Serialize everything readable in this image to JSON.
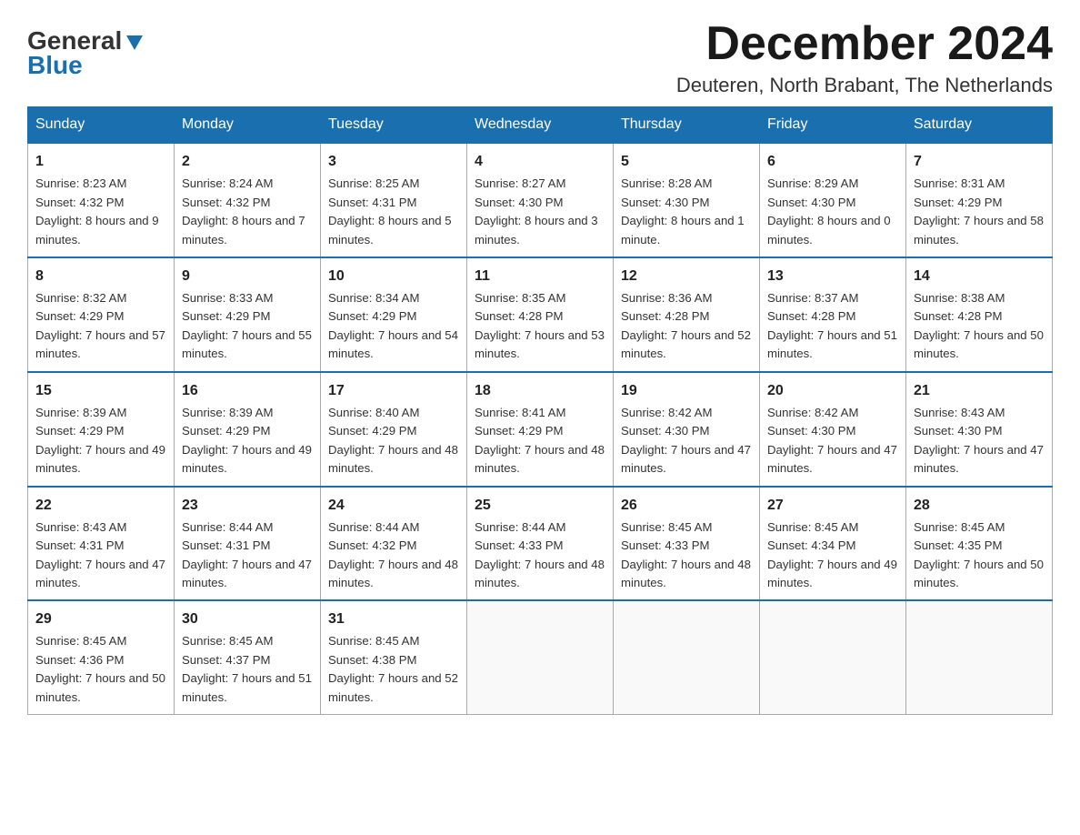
{
  "logo": {
    "text_general": "General",
    "text_blue": "Blue"
  },
  "header": {
    "month_title": "December 2024",
    "location": "Deuteren, North Brabant, The Netherlands"
  },
  "weekdays": [
    "Sunday",
    "Monday",
    "Tuesday",
    "Wednesday",
    "Thursday",
    "Friday",
    "Saturday"
  ],
  "weeks": [
    [
      {
        "day": "1",
        "sunrise": "8:23 AM",
        "sunset": "4:32 PM",
        "daylight": "8 hours and 9 minutes."
      },
      {
        "day": "2",
        "sunrise": "8:24 AM",
        "sunset": "4:32 PM",
        "daylight": "8 hours and 7 minutes."
      },
      {
        "day": "3",
        "sunrise": "8:25 AM",
        "sunset": "4:31 PM",
        "daylight": "8 hours and 5 minutes."
      },
      {
        "day": "4",
        "sunrise": "8:27 AM",
        "sunset": "4:30 PM",
        "daylight": "8 hours and 3 minutes."
      },
      {
        "day": "5",
        "sunrise": "8:28 AM",
        "sunset": "4:30 PM",
        "daylight": "8 hours and 1 minute."
      },
      {
        "day": "6",
        "sunrise": "8:29 AM",
        "sunset": "4:30 PM",
        "daylight": "8 hours and 0 minutes."
      },
      {
        "day": "7",
        "sunrise": "8:31 AM",
        "sunset": "4:29 PM",
        "daylight": "7 hours and 58 minutes."
      }
    ],
    [
      {
        "day": "8",
        "sunrise": "8:32 AM",
        "sunset": "4:29 PM",
        "daylight": "7 hours and 57 minutes."
      },
      {
        "day": "9",
        "sunrise": "8:33 AM",
        "sunset": "4:29 PM",
        "daylight": "7 hours and 55 minutes."
      },
      {
        "day": "10",
        "sunrise": "8:34 AM",
        "sunset": "4:29 PM",
        "daylight": "7 hours and 54 minutes."
      },
      {
        "day": "11",
        "sunrise": "8:35 AM",
        "sunset": "4:28 PM",
        "daylight": "7 hours and 53 minutes."
      },
      {
        "day": "12",
        "sunrise": "8:36 AM",
        "sunset": "4:28 PM",
        "daylight": "7 hours and 52 minutes."
      },
      {
        "day": "13",
        "sunrise": "8:37 AM",
        "sunset": "4:28 PM",
        "daylight": "7 hours and 51 minutes."
      },
      {
        "day": "14",
        "sunrise": "8:38 AM",
        "sunset": "4:28 PM",
        "daylight": "7 hours and 50 minutes."
      }
    ],
    [
      {
        "day": "15",
        "sunrise": "8:39 AM",
        "sunset": "4:29 PM",
        "daylight": "7 hours and 49 minutes."
      },
      {
        "day": "16",
        "sunrise": "8:39 AM",
        "sunset": "4:29 PM",
        "daylight": "7 hours and 49 minutes."
      },
      {
        "day": "17",
        "sunrise": "8:40 AM",
        "sunset": "4:29 PM",
        "daylight": "7 hours and 48 minutes."
      },
      {
        "day": "18",
        "sunrise": "8:41 AM",
        "sunset": "4:29 PM",
        "daylight": "7 hours and 48 minutes."
      },
      {
        "day": "19",
        "sunrise": "8:42 AM",
        "sunset": "4:30 PM",
        "daylight": "7 hours and 47 minutes."
      },
      {
        "day": "20",
        "sunrise": "8:42 AM",
        "sunset": "4:30 PM",
        "daylight": "7 hours and 47 minutes."
      },
      {
        "day": "21",
        "sunrise": "8:43 AM",
        "sunset": "4:30 PM",
        "daylight": "7 hours and 47 minutes."
      }
    ],
    [
      {
        "day": "22",
        "sunrise": "8:43 AM",
        "sunset": "4:31 PM",
        "daylight": "7 hours and 47 minutes."
      },
      {
        "day": "23",
        "sunrise": "8:44 AM",
        "sunset": "4:31 PM",
        "daylight": "7 hours and 47 minutes."
      },
      {
        "day": "24",
        "sunrise": "8:44 AM",
        "sunset": "4:32 PM",
        "daylight": "7 hours and 48 minutes."
      },
      {
        "day": "25",
        "sunrise": "8:44 AM",
        "sunset": "4:33 PM",
        "daylight": "7 hours and 48 minutes."
      },
      {
        "day": "26",
        "sunrise": "8:45 AM",
        "sunset": "4:33 PM",
        "daylight": "7 hours and 48 minutes."
      },
      {
        "day": "27",
        "sunrise": "8:45 AM",
        "sunset": "4:34 PM",
        "daylight": "7 hours and 49 minutes."
      },
      {
        "day": "28",
        "sunrise": "8:45 AM",
        "sunset": "4:35 PM",
        "daylight": "7 hours and 50 minutes."
      }
    ],
    [
      {
        "day": "29",
        "sunrise": "8:45 AM",
        "sunset": "4:36 PM",
        "daylight": "7 hours and 50 minutes."
      },
      {
        "day": "30",
        "sunrise": "8:45 AM",
        "sunset": "4:37 PM",
        "daylight": "7 hours and 51 minutes."
      },
      {
        "day": "31",
        "sunrise": "8:45 AM",
        "sunset": "4:38 PM",
        "daylight": "7 hours and 52 minutes."
      },
      null,
      null,
      null,
      null
    ]
  ],
  "labels": {
    "sunrise": "Sunrise:",
    "sunset": "Sunset:",
    "daylight": "Daylight:"
  }
}
